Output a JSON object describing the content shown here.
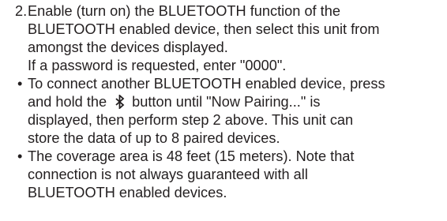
{
  "step": {
    "number": "2.",
    "lines": [
      "Enable (turn on) the BLUETOOTH function of the",
      "BLUETOOTH enabled device, then select this unit from",
      "amongst the devices displayed."
    ],
    "note": "If a password is requested, enter \"0000\"."
  },
  "bullets": [
    {
      "mark": "•",
      "line1": "To connect another BLUETOOTH enabled device, press",
      "line2_before": "and hold the",
      "line2_icon": "bluetooth-icon",
      "line2_after": "button until \"Now Pairing...\" is",
      "line3": "displayed, then perform step 2 above. This unit can",
      "line4": "store the data of up to 8 paired devices."
    },
    {
      "mark": "•",
      "line1": "The coverage area is 48 feet (15 meters). Note that",
      "line2": "connection is not always guaranteed with all",
      "line3": "BLUETOOTH enabled devices."
    }
  ]
}
